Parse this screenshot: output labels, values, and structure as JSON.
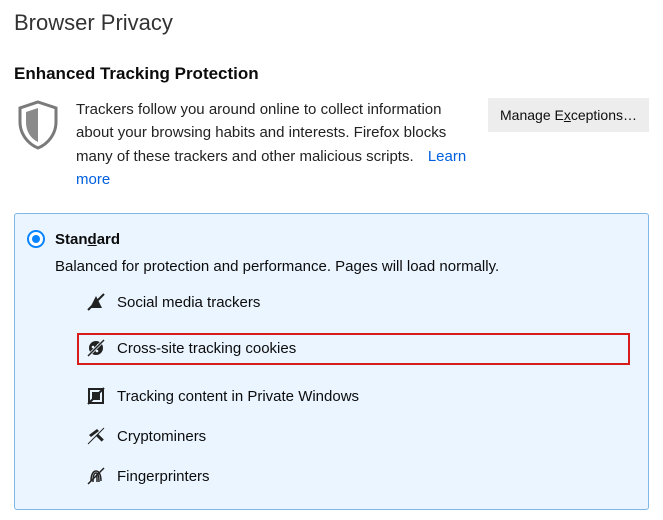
{
  "page": {
    "title": "Browser Privacy"
  },
  "etp": {
    "heading": "Enhanced Tracking Protection",
    "intro": "Trackers follow you around online to collect information about your browsing habits and interests. Firefox blocks many of these trackers and other malicious scripts.",
    "learn_more": "Learn more",
    "manage_exceptions_prefix": "Manage E",
    "manage_exceptions_key": "x",
    "manage_exceptions_suffix": "ceptions…"
  },
  "panel": {
    "title_prefix": "Stan",
    "title_key": "d",
    "title_suffix": "ard",
    "description": "Balanced for protection and performance. Pages will load normally.",
    "items": [
      {
        "label": "Social media trackers",
        "icon": "social"
      },
      {
        "label": "Cross-site tracking cookies",
        "icon": "cookie"
      },
      {
        "label": "Tracking content in Private Windows",
        "icon": "tracking-content"
      },
      {
        "label": "Cryptominers",
        "icon": "cryptominer"
      },
      {
        "label": "Fingerprinters",
        "icon": "fingerprinter"
      }
    ]
  }
}
